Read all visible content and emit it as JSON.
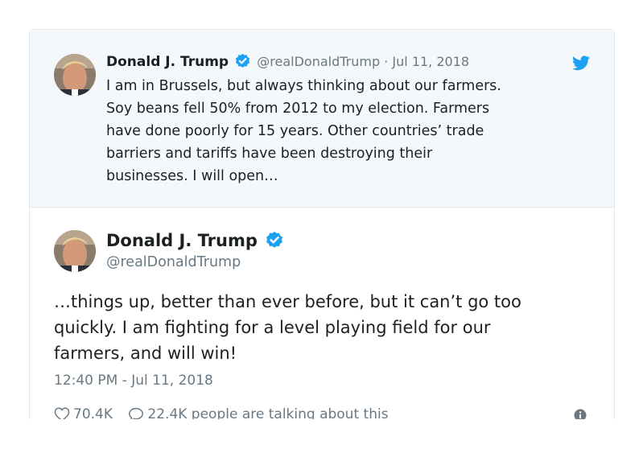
{
  "quoted_tweet": {
    "author_name": "Donald J. Trump",
    "handle": "@realDonaldTrump",
    "separator": "·",
    "date": "Jul 11, 2018",
    "text_lines": [
      "I am in Brussels, but always thinking about our farmers.",
      "Soy beans fell 50% from 2012 to my election. Farmers",
      "have done poorly for 15 years. Other countries’ trade",
      "barriers and tariffs have been destroying their",
      "businesses. I will open…"
    ]
  },
  "main_tweet": {
    "author_name": "Donald J. Trump",
    "handle": "@realDonaldTrump",
    "text_lines": [
      "…things up, better than ever before, but it can’t go too",
      "quickly. I am fighting for a level playing field for our",
      "farmers, and will win!"
    ],
    "timestamp": "12:40 PM - Jul 11, 2018",
    "likes": "70.4K",
    "replies_text": "22.4K people are talking about this"
  },
  "icons": {
    "verified": "verified-badge-icon",
    "bird": "twitter-bird-icon",
    "heart": "heart-icon",
    "comment": "comment-icon",
    "info": "info-icon"
  },
  "colors": {
    "twitter_blue": "#1da1f2",
    "secondary_text": "#697882",
    "quoted_bg": "#f5f8fa"
  }
}
